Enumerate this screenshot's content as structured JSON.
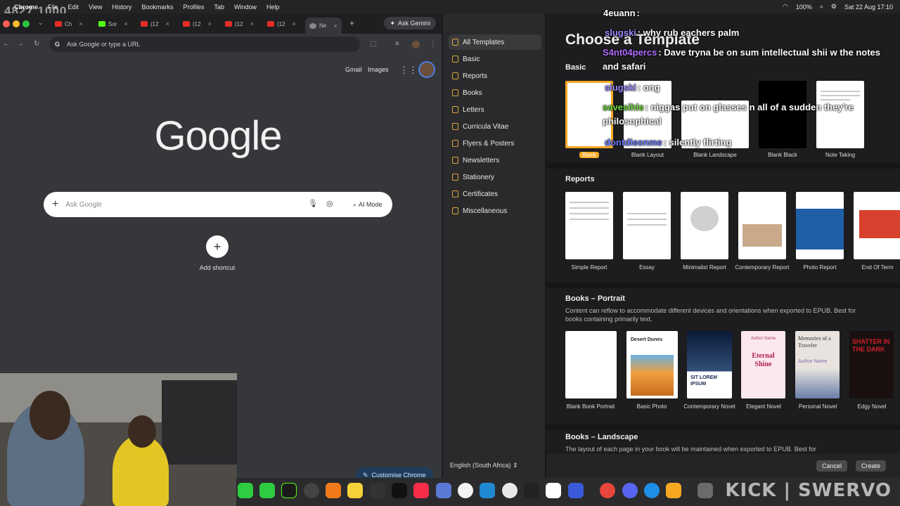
{
  "stream": {
    "counter": "4827 1000",
    "watermark": "KICK | SWERVO"
  },
  "menubar": {
    "app": "Chrome",
    "items": [
      "File",
      "Edit",
      "View",
      "History",
      "Bookmarks",
      "Profiles",
      "Tab",
      "Window",
      "Help"
    ],
    "battery": "100%",
    "datetime": "Sat 22 Aug  17:10"
  },
  "chrome": {
    "tabs": [
      {
        "label": "Ch"
      },
      {
        "label": "Sor"
      },
      {
        "label": "(12"
      },
      {
        "label": "(12"
      },
      {
        "label": "(12"
      },
      {
        "label": "(12"
      },
      {
        "label": "Ne"
      }
    ],
    "ask_gemini": "Ask Gemini",
    "omnibox_placeholder": "Ask Google or type a URL",
    "ntp": {
      "gmail": "Gmail",
      "images": "Images",
      "logo": "Google",
      "search_placeholder": "Ask Google",
      "ai_mode": "AI Mode",
      "add_shortcut": "Add shortcut",
      "customise": "Customise Chrome"
    }
  },
  "pages": {
    "sidebar": [
      {
        "label": "All Templates"
      },
      {
        "label": "Basic"
      },
      {
        "label": "Reports"
      },
      {
        "label": "Books"
      },
      {
        "label": "Letters"
      },
      {
        "label": "Curricula Vitae"
      },
      {
        "label": "Flyers & Posters"
      },
      {
        "label": "Newsletters"
      },
      {
        "label": "Stationery"
      },
      {
        "label": "Certificates"
      },
      {
        "label": "Miscellaneous"
      }
    ],
    "language": "English (South Africa)",
    "title": "Choose a Template",
    "sections": {
      "basic": {
        "heading": "Basic",
        "templates": [
          "Blank",
          "Blank Layout",
          "Blank Landscape",
          "Blank Black",
          "Note Taking"
        ]
      },
      "reports": {
        "heading": "Reports",
        "templates": [
          "Simple Report",
          "Essay",
          "Minimalist Report",
          "Contemporary Report",
          "Photo Report",
          "End Of Term"
        ]
      },
      "books_portrait": {
        "heading": "Books – Portrait",
        "description": "Content can reflow to accommodate different devices and orientations when exported to EPUB. Best for books containing primarily text.",
        "templates": [
          "Blank Book Portrait",
          "Basic Photo",
          "Contemporary Novel",
          "Elegant Novel",
          "Personal Novel",
          "Edgy Novel"
        ],
        "cover_texts": {
          "basic_photo": "Desert Dunes",
          "contemporary": "SIT LOREM IPSUM",
          "elegant_title": "Eternal Shine",
          "elegant_author": "Author Name",
          "personal_title": "Memories of a Traveler",
          "personal_author": "Author Name",
          "edgy": "SHATTER IN THE DARK"
        }
      },
      "books_landscape": {
        "heading": "Books – Landscape",
        "description": "The layout of each page in your book will be maintained when exported to EPUB. Best for"
      }
    },
    "cancel": "Cancel",
    "create": "Create"
  },
  "chat": [
    {
      "user": "4euann",
      "text": ":",
      "color": "#ffffff"
    },
    {
      "user": "slugski",
      "text": ": why rub eachers palm",
      "color": "#9a8cff"
    },
    {
      "user": "S4nt04percs",
      "text": ": Dave tryna be on sum intellectual shii w the notes and safari",
      "color": "#b06cff"
    },
    {
      "user": "slugski",
      "text": ": ong",
      "color": "#9a8cff"
    },
    {
      "user": "savesihle",
      "text": ": niggas put on glasses n all of a sudden they're philosophical",
      "color": "#6fdc3c"
    },
    {
      "user": "dontdieonme",
      "text": ": silently flirting",
      "color": "#6f7cff"
    }
  ],
  "colors": {
    "accent": "#f7a823",
    "link_blue": "#4a7ee8"
  }
}
